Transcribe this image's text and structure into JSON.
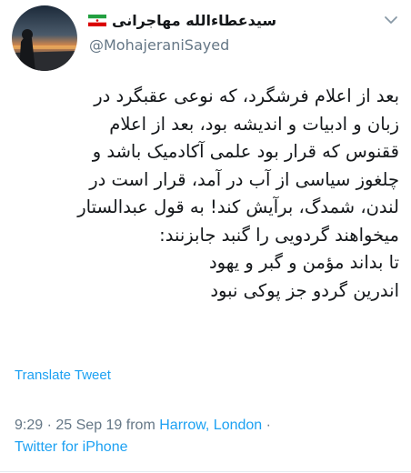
{
  "author": {
    "display_name": "سیدعطاءالله مهاجرانی",
    "handle": "@MohajeraniSayed",
    "flag_icon": "iran-flag-icon"
  },
  "tweet": {
    "lines": [
      "بعد از اعلام فرشگرد، که نوعی عقبگرد در",
      "زبان و ادبیات و اندیشه بود، بعد از اعلام",
      "ققنوس که قرار بود علمی آکادمیک باشد و",
      "چلغوز سیاسی از آب در آمد، قرار است در",
      "لندن، شمدگ، برآیش کند! به قول عبدالستار",
      "میخواهند گردویی را گنبد جابزنند:",
      "تا بداند مؤمن و گبر و یهود",
      "اندرین گردو جز پوکی نبود"
    ]
  },
  "translate_label": "Translate Tweet",
  "meta": {
    "time": "9:29",
    "date": "25 Sep 19",
    "from_label": "from",
    "location": "Harrow, London",
    "separator": "·",
    "source": "Twitter for iPhone"
  },
  "colors": {
    "link": "#1da1f2",
    "muted": "#657786",
    "text": "#14171a"
  },
  "icons": {
    "menu": "chevron-down-icon"
  }
}
